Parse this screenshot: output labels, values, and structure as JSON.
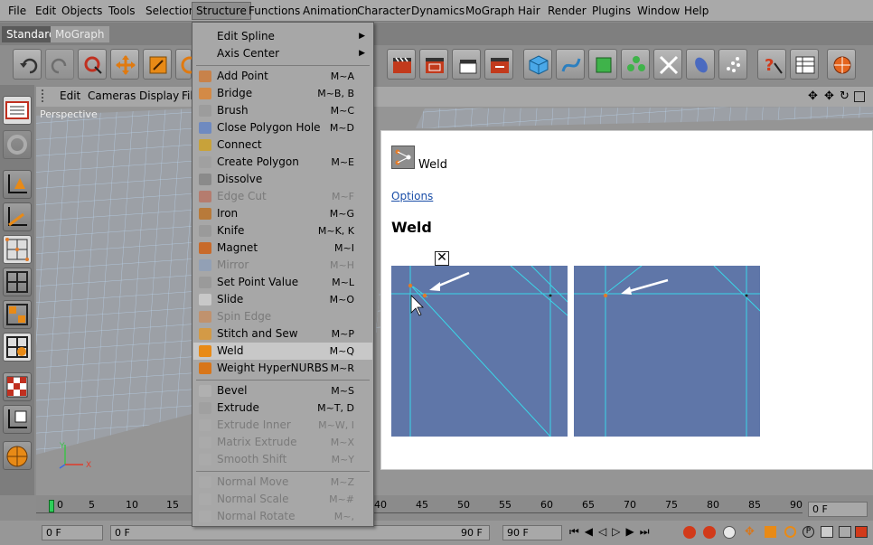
{
  "menubar": {
    "items": [
      "File",
      "Edit",
      "Objects",
      "Tools",
      "Selection",
      "Structure",
      "Functions",
      "Animation",
      "Character",
      "Dynamics",
      "MoGraph",
      "Hair",
      "Render",
      "Plugins",
      "Window",
      "Help"
    ],
    "active": "Structure"
  },
  "layout_tabs": [
    "Standard",
    "MoGraph"
  ],
  "viewport": {
    "menu": [
      "Edit",
      "Cameras",
      "Display",
      "Fil"
    ],
    "label": "Perspective"
  },
  "structure_menu": {
    "items": [
      {
        "label": "Edit Spline",
        "shortcut": "",
        "submenu": true,
        "enabled": true
      },
      {
        "label": "Axis Center",
        "shortcut": "",
        "submenu": true,
        "enabled": true
      },
      {
        "label": "Add Point",
        "shortcut": "M~A",
        "enabled": true
      },
      {
        "label": "Bridge",
        "shortcut": "M~B, B",
        "enabled": true
      },
      {
        "label": "Brush",
        "shortcut": "M~C",
        "enabled": true
      },
      {
        "label": "Close Polygon Hole",
        "shortcut": "M~D",
        "enabled": true
      },
      {
        "label": "Connect",
        "shortcut": "",
        "enabled": true
      },
      {
        "label": "Create Polygon",
        "shortcut": "M~E",
        "enabled": true
      },
      {
        "label": "Dissolve",
        "shortcut": "",
        "enabled": true
      },
      {
        "label": "Edge Cut",
        "shortcut": "M~F",
        "enabled": false
      },
      {
        "label": "Iron",
        "shortcut": "M~G",
        "enabled": true
      },
      {
        "label": "Knife",
        "shortcut": "M~K, K",
        "enabled": true
      },
      {
        "label": "Magnet",
        "shortcut": "M~I",
        "enabled": true
      },
      {
        "label": "Mirror",
        "shortcut": "M~H",
        "enabled": false
      },
      {
        "label": "Set Point Value",
        "shortcut": "M~L",
        "enabled": true
      },
      {
        "label": "Slide",
        "shortcut": "M~O",
        "enabled": true
      },
      {
        "label": "Spin Edge",
        "shortcut": "",
        "enabled": false
      },
      {
        "label": "Stitch and Sew",
        "shortcut": "M~P",
        "enabled": true
      },
      {
        "label": "Weld",
        "shortcut": "M~Q",
        "enabled": true,
        "highlighted": true
      },
      {
        "label": "Weight HyperNURBS",
        "shortcut": "M~R",
        "enabled": true
      },
      {
        "label": "Bevel",
        "shortcut": "M~S",
        "enabled": true
      },
      {
        "label": "Extrude",
        "shortcut": "M~T, D",
        "enabled": true
      },
      {
        "label": "Extrude Inner",
        "shortcut": "M~W, I",
        "enabled": false
      },
      {
        "label": "Matrix Extrude",
        "shortcut": "M~X",
        "enabled": false
      },
      {
        "label": "Smooth Shift",
        "shortcut": "M~Y",
        "enabled": false
      },
      {
        "label": "Normal Move",
        "shortcut": "M~Z",
        "enabled": false
      },
      {
        "label": "Normal Scale",
        "shortcut": "M~#",
        "enabled": false
      },
      {
        "label": "Normal Rotate",
        "shortcut": "M~,",
        "enabled": false
      }
    ]
  },
  "help_popup": {
    "title": "Weld",
    "link": "Options",
    "heading": "Weld",
    "close": "✕"
  },
  "timeline": {
    "ticks": [
      "0",
      "5",
      "10",
      "15",
      "40",
      "45",
      "50",
      "55",
      "60",
      "65",
      "70",
      "75",
      "80",
      "85",
      "90"
    ],
    "frame_field": "0 F"
  },
  "bottom": {
    "start": "0 F",
    "range_start": "0 F",
    "range_end": "90 F",
    "end": "90 F"
  },
  "colors": {
    "menu_bg": "#a7a7a7",
    "highlight": "#c8c8c8",
    "help_link": "#1a4ea8",
    "diagram_bg": "#5f76a8",
    "edge": "#3ad6e8",
    "point": "#e07a2a"
  }
}
